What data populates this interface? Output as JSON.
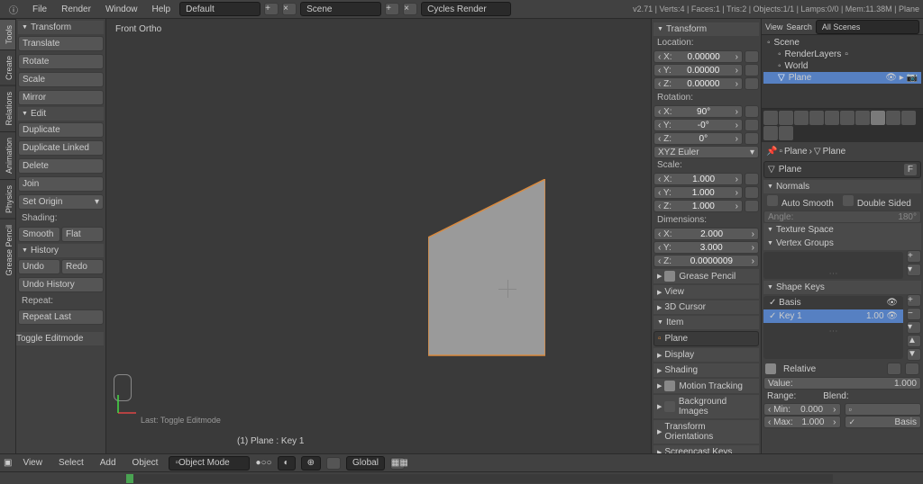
{
  "menu": [
    "File",
    "Render",
    "Window",
    "Help"
  ],
  "layout": "Default",
  "scene": "Scene",
  "renderer": "Cycles Render",
  "stats": "v2.71 | Verts:4 | Faces:1 | Tris:2 | Objects:1/1 | Lamps:0/0 | Mem:11.38M | Plane",
  "view3d": {
    "label": "Front Ortho",
    "last_op": "Last: Toggle Editmode",
    "selection": "(1) Plane : Key 1",
    "header": {
      "view": "View",
      "select": "Select",
      "add": "Add",
      "object": "Object",
      "mode": "Object Mode",
      "orient": "Global"
    }
  },
  "toolbar": {
    "transform": "Transform",
    "translate": "Translate",
    "rotate": "Rotate",
    "scale": "Scale",
    "mirror": "Mirror",
    "edit": "Edit",
    "duplicate": "Duplicate",
    "duplicate_linked": "Duplicate Linked",
    "delete": "Delete",
    "join": "Join",
    "set_origin": "Set Origin",
    "shading": "Shading:",
    "smooth": "Smooth",
    "flat": "Flat",
    "history": "History",
    "undo": "Undo",
    "redo": "Redo",
    "undo_history": "Undo History",
    "repeat": "Repeat:",
    "repeat_last": "Repeat Last",
    "toggle_editmode": "Toggle Editmode"
  },
  "npanel": {
    "transform": "Transform",
    "location": "Location:",
    "loc": {
      "x": "0.00000",
      "y": "0.00000",
      "z": "0.00000"
    },
    "rotation": "Rotation:",
    "rot": {
      "x": "90°",
      "y": "-0°",
      "z": "0°"
    },
    "rot_mode": "XYZ Euler",
    "scale": "Scale:",
    "scl": {
      "x": "1.000",
      "y": "1.000",
      "z": "1.000"
    },
    "dimensions": "Dimensions:",
    "dim": {
      "x": "2.000",
      "y": "3.000",
      "z": "0.0000009"
    },
    "grease": "Grease Pencil",
    "view": "View",
    "cursor": "3D Cursor",
    "item": "Item",
    "item_name": "Plane",
    "display": "Display",
    "shading": "Shading",
    "motion": "Motion Tracking",
    "bg": "Background Images",
    "tori": "Transform Orientations",
    "screencast": "Screencast Keys"
  },
  "outliner": {
    "view": "View",
    "search": "Search",
    "filter": "All Scenes",
    "tree": [
      {
        "name": "Scene",
        "indent": 0
      },
      {
        "name": "RenderLayers",
        "indent": 1
      },
      {
        "name": "World",
        "indent": 1
      },
      {
        "name": "Plane",
        "indent": 1,
        "selected": true
      }
    ]
  },
  "props": {
    "crumb1": "Plane",
    "crumb2": "Plane",
    "name": "Plane",
    "f": "F",
    "normals": "Normals",
    "auto_smooth": "Auto Smooth",
    "double_sided": "Double Sided",
    "angle": "Angle:",
    "angle_val": "180°",
    "texspace": "Texture Space",
    "vgroups": "Vertex Groups",
    "shapekeys": "Shape Keys",
    "keys": [
      {
        "name": "Basis",
        "val": ""
      },
      {
        "name": "Key 1",
        "val": "1.00",
        "selected": true
      }
    ],
    "relative": "Relative",
    "value": "Value:",
    "value_val": "1.000",
    "range": "Range:",
    "blend": "Blend:",
    "min": "Min:",
    "min_val": "0.000",
    "max": "Max:",
    "max_val": "1.000",
    "basis_blend": "Basis"
  },
  "vtabs": [
    "Tools",
    "Create",
    "Relations",
    "Animation",
    "Physics",
    "Grease Pencil"
  ]
}
